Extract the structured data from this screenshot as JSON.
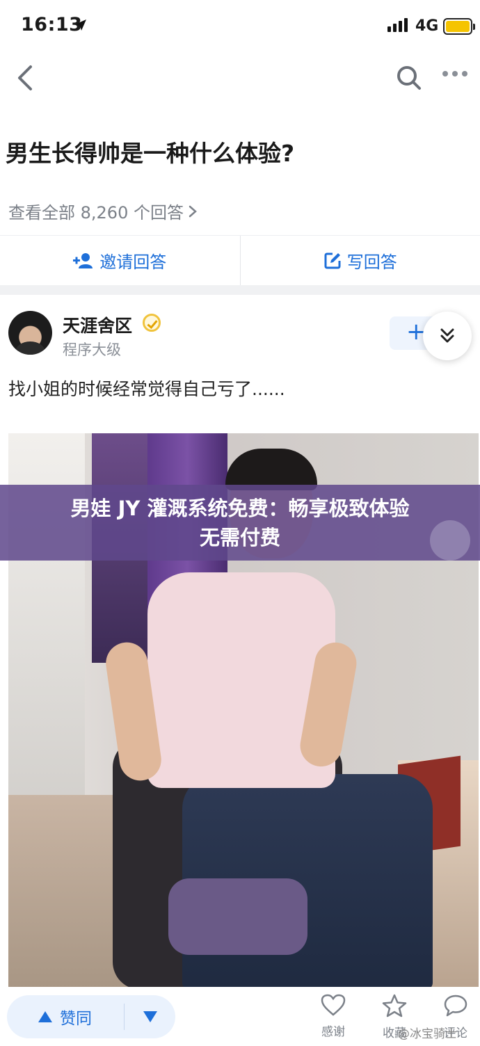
{
  "status_bar": {
    "time": "16:13",
    "network": "4G"
  },
  "nav": {
    "back_icon": "chevron-left-icon",
    "search_icon": "search-icon",
    "more_icon": "more-horizontal-icon"
  },
  "question": {
    "title": "男生长得帅是一种什么体验?",
    "view_all": "查看全部 8,260 个回答"
  },
  "actions": {
    "invite_label": "邀请回答",
    "write_label": "写回答"
  },
  "answer": {
    "author_name": "天涯舍区",
    "author_title": "程序大级",
    "follow_label": "+",
    "text": "找小姐的时候经常觉得自己亏了......"
  },
  "overlay": {
    "line1": "男娃 JY 灌溉系统免费：畅享极致体验",
    "line2": "无需付费"
  },
  "bottom_bar": {
    "upvote_label": "赞同",
    "thanks_label": "感谢",
    "collect_label": "收藏",
    "comment_label": "评论"
  },
  "watermark": "@冰宝骑士",
  "colors": {
    "accent": "#1e6fd9",
    "overlay": "#60488c",
    "battery": "#f5c400"
  }
}
